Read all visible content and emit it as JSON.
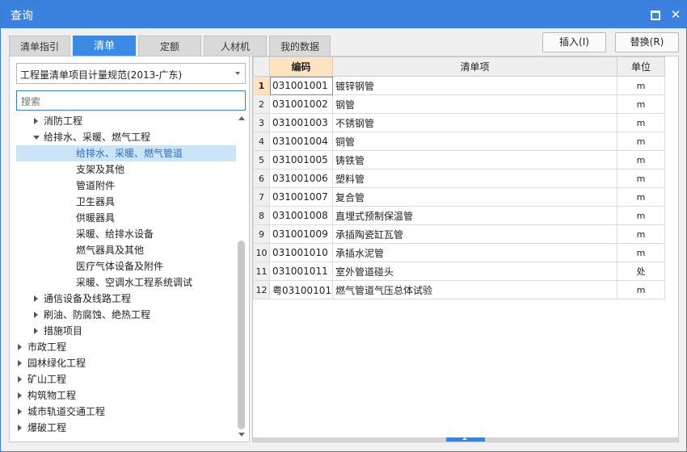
{
  "window": {
    "title": "查询",
    "accent": "#3b82e0"
  },
  "tabs": [
    "清单指引",
    "清单",
    "定额",
    "人材机",
    "我的数据"
  ],
  "active_tab": 1,
  "actions": {
    "insert_label": "插入(I)",
    "replace_label": "替换(R)"
  },
  "left": {
    "spec_select": "工程量清单项目计量规范(2013-广东)",
    "search_placeholder": "搜索",
    "tree": [
      {
        "label": "消防工程",
        "level": 1,
        "state": "collapsed"
      },
      {
        "label": "给排水、采暖、燃气工程",
        "level": 1,
        "state": "expanded"
      },
      {
        "label": "给排水、采暖、燃气管道",
        "level": 2,
        "state": "leaf",
        "selected": true
      },
      {
        "label": "支架及其他",
        "level": 2,
        "state": "leaf"
      },
      {
        "label": "管道附件",
        "level": 2,
        "state": "leaf"
      },
      {
        "label": "卫生器具",
        "level": 2,
        "state": "leaf"
      },
      {
        "label": "供暖器具",
        "level": 2,
        "state": "leaf"
      },
      {
        "label": "采暖、给排水设备",
        "level": 2,
        "state": "leaf"
      },
      {
        "label": "燃气器具及其他",
        "level": 2,
        "state": "leaf"
      },
      {
        "label": "医疗气体设备及附件",
        "level": 2,
        "state": "leaf"
      },
      {
        "label": "采暖、空调水工程系统调试",
        "level": 2,
        "state": "leaf"
      },
      {
        "label": "通信设备及线路工程",
        "level": 1,
        "state": "collapsed"
      },
      {
        "label": "刷油、防腐蚀、绝热工程",
        "level": 1,
        "state": "collapsed"
      },
      {
        "label": "措施项目",
        "level": 1,
        "state": "collapsed"
      },
      {
        "label": "市政工程",
        "level": 0,
        "state": "collapsed"
      },
      {
        "label": "园林绿化工程",
        "level": 0,
        "state": "collapsed"
      },
      {
        "label": "矿山工程",
        "level": 0,
        "state": "collapsed"
      },
      {
        "label": "构筑物工程",
        "level": 0,
        "state": "collapsed"
      },
      {
        "label": "城市轨道交通工程",
        "level": 0,
        "state": "collapsed"
      },
      {
        "label": "爆破工程",
        "level": 0,
        "state": "collapsed"
      }
    ]
  },
  "grid": {
    "columns": [
      "编码",
      "清单项",
      "单位"
    ],
    "rows": [
      {
        "no": "1",
        "code": "031001001",
        "name": "镀锌钢管",
        "unit": "m"
      },
      {
        "no": "2",
        "code": "031001002",
        "name": "钢管",
        "unit": "m"
      },
      {
        "no": "3",
        "code": "031001003",
        "name": "不锈钢管",
        "unit": "m"
      },
      {
        "no": "4",
        "code": "031001004",
        "name": "铜管",
        "unit": "m"
      },
      {
        "no": "5",
        "code": "031001005",
        "name": "铸铁管",
        "unit": "m"
      },
      {
        "no": "6",
        "code": "031001006",
        "name": "塑料管",
        "unit": "m"
      },
      {
        "no": "7",
        "code": "031001007",
        "name": "复合管",
        "unit": "m"
      },
      {
        "no": "8",
        "code": "031001008",
        "name": "直埋式预制保温管",
        "unit": "m"
      },
      {
        "no": "9",
        "code": "031001009",
        "name": "承插陶瓷缸瓦管",
        "unit": "m"
      },
      {
        "no": "10",
        "code": "031001010",
        "name": "承插水泥管",
        "unit": "m"
      },
      {
        "no": "11",
        "code": "031001011",
        "name": "室外管道碰头",
        "unit": "处"
      },
      {
        "no": "12",
        "code": "粤031001012",
        "name": "燃气管道气压总体试验",
        "unit": "m"
      }
    ]
  }
}
